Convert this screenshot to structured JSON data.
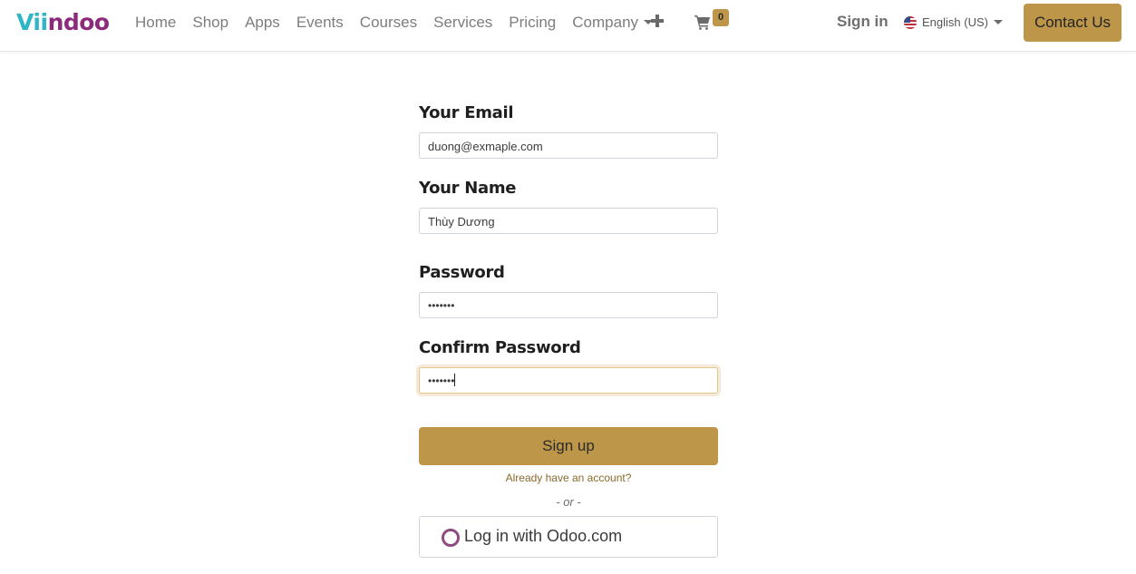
{
  "brand": {
    "logo_part1": "Vii",
    "logo_part2": "ndoo",
    "accent": "#bd9649",
    "logo_teal": "#2fb6c4",
    "logo_purple": "#8c2a7c"
  },
  "nav": {
    "items": [
      {
        "label": "Home"
      },
      {
        "label": "Shop"
      },
      {
        "label": "Apps"
      },
      {
        "label": "Events"
      },
      {
        "label": "Courses"
      },
      {
        "label": "Services"
      },
      {
        "label": "Pricing"
      },
      {
        "label": "Company"
      }
    ],
    "plus_icon": "plus-icon",
    "cart_icon": "shopping-cart-icon",
    "cart_count": "0",
    "signin_label": "Sign in",
    "language_label": "English (US)",
    "contact_label": "Contact Us"
  },
  "form": {
    "email": {
      "label": "Your Email",
      "value": "duong@exmaple.com"
    },
    "name": {
      "label": "Your Name",
      "value": "Thùy Dương"
    },
    "password": {
      "label": "Password",
      "value": "•••••••"
    },
    "confirm": {
      "label": "Confirm Password",
      "value": "•••••••"
    },
    "signup_label": "Sign up",
    "already_label": "Already have an account?",
    "or_label": "- or -",
    "odoo_login_label": "Log in with Odoo.com"
  }
}
